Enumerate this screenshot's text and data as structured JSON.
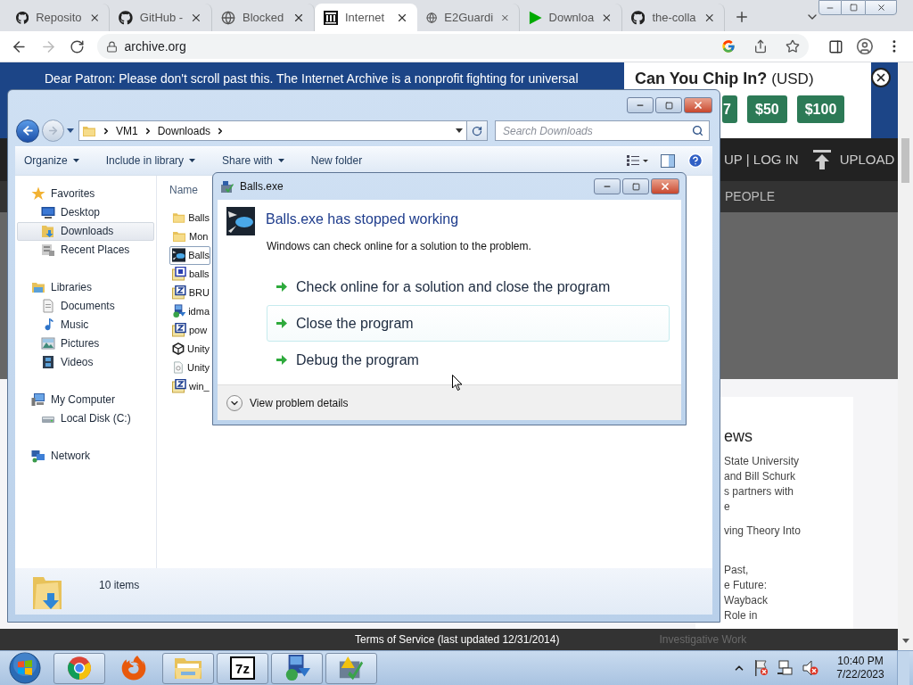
{
  "browser": {
    "tabs": [
      {
        "title": "Reposito",
        "kind": "github",
        "selected": false
      },
      {
        "title": "GitHub -",
        "kind": "github",
        "selected": false
      },
      {
        "title": "Blocked",
        "kind": "globe",
        "selected": false
      },
      {
        "title": "Internet",
        "kind": "archive",
        "selected": true
      },
      {
        "title": "E2Guardi",
        "kind": "globe",
        "selected": false
      },
      {
        "title": "Downloa",
        "kind": "play",
        "selected": false
      },
      {
        "title": "the-colla",
        "kind": "github",
        "selected": false
      }
    ],
    "address": "archive.org"
  },
  "page": {
    "banner": {
      "message": "Dear Patron: Please don't scroll past this. The Internet Archive is a nonprofit fighting for universal",
      "heading": "Can You Chip In?",
      "currency": "(USD)",
      "amounts": [
        "7",
        "$50",
        "$100"
      ]
    },
    "nav": {
      "account": "UP | LOG IN",
      "upload": "UPLOAD",
      "section": "PEOPLE"
    },
    "news": {
      "heading": "ews",
      "items": [
        {
          "lines": [
            "State University",
            "and Bill Schurk",
            "s partners with",
            "e"
          ]
        },
        {
          "lines": [
            "ving Theory Into"
          ]
        },
        {
          "lines": [
            "Past,",
            "e Future:",
            "Wayback",
            "Role in"
          ]
        }
      ]
    },
    "footer": {
      "terms": "Terms of Service (last updated 12/31/2014)",
      "behind": "Investigative Work"
    }
  },
  "explorer": {
    "path": [
      "VM1",
      "Downloads"
    ],
    "search_placeholder": "Search Downloads",
    "toolbar": [
      {
        "label": "Organize",
        "dropdown": true
      },
      {
        "label": "Include in library",
        "dropdown": true
      },
      {
        "label": "Share with",
        "dropdown": true
      },
      {
        "label": "New folder",
        "dropdown": false
      }
    ],
    "nav": [
      {
        "label": "Favorites",
        "kind": "star",
        "selected": false,
        "children": [
          {
            "label": "Desktop",
            "kind": "desktop",
            "selected": false
          },
          {
            "label": "Downloads",
            "kind": "downloads",
            "selected": true
          },
          {
            "label": "Recent Places",
            "kind": "recent",
            "selected": false
          }
        ]
      },
      {
        "label": "Libraries",
        "kind": "libraries",
        "selected": false,
        "children": [
          {
            "label": "Documents",
            "kind": "documents",
            "selected": false
          },
          {
            "label": "Music",
            "kind": "music",
            "selected": false
          },
          {
            "label": "Pictures",
            "kind": "pictures",
            "selected": false
          },
          {
            "label": "Videos",
            "kind": "videos",
            "selected": false
          }
        ]
      },
      {
        "label": "My Computer",
        "kind": "computer",
        "selected": false,
        "children": [
          {
            "label": "Local Disk (C:)",
            "kind": "disk",
            "selected": false
          }
        ]
      },
      {
        "label": "Network",
        "kind": "network",
        "selected": false
      }
    ],
    "column": "Name",
    "files": [
      {
        "name": "Balls",
        "kind": "folder",
        "selected": false
      },
      {
        "name": "Mon",
        "kind": "folder",
        "selected": false
      },
      {
        "name": "Balls",
        "kind": "app",
        "selected": true
      },
      {
        "name": "balls",
        "kind": "rar",
        "selected": false
      },
      {
        "name": "BRU",
        "kind": "zip",
        "selected": false
      },
      {
        "name": "idma",
        "kind": "installer",
        "selected": false
      },
      {
        "name": "pow",
        "kind": "zip",
        "selected": false
      },
      {
        "name": "Unity",
        "kind": "unity",
        "selected": false
      },
      {
        "name": "Unity",
        "kind": "file",
        "selected": false
      },
      {
        "name": "win_",
        "kind": "zip",
        "selected": false
      }
    ],
    "status": "10 items"
  },
  "dialog": {
    "title": "Balls.exe",
    "heading": "Balls.exe has stopped working",
    "message": "Windows can check online for a solution to the problem.",
    "options": [
      {
        "label": "Check online for a solution and close the program",
        "highlighted": false
      },
      {
        "label": "Close the program",
        "highlighted": true
      },
      {
        "label": "Debug the program",
        "highlighted": false
      }
    ],
    "details": "View problem details"
  },
  "taskbar": {
    "apps": [
      {
        "kind": "chrome",
        "running": true
      },
      {
        "kind": "firefox",
        "running": false
      },
      {
        "kind": "explorer",
        "running": true
      },
      {
        "kind": "archiver",
        "label": "7z",
        "running": true
      },
      {
        "kind": "installer",
        "running": true
      },
      {
        "kind": "report",
        "running": true
      }
    ],
    "time": "10:40 PM",
    "date": "7/22/2023"
  }
}
